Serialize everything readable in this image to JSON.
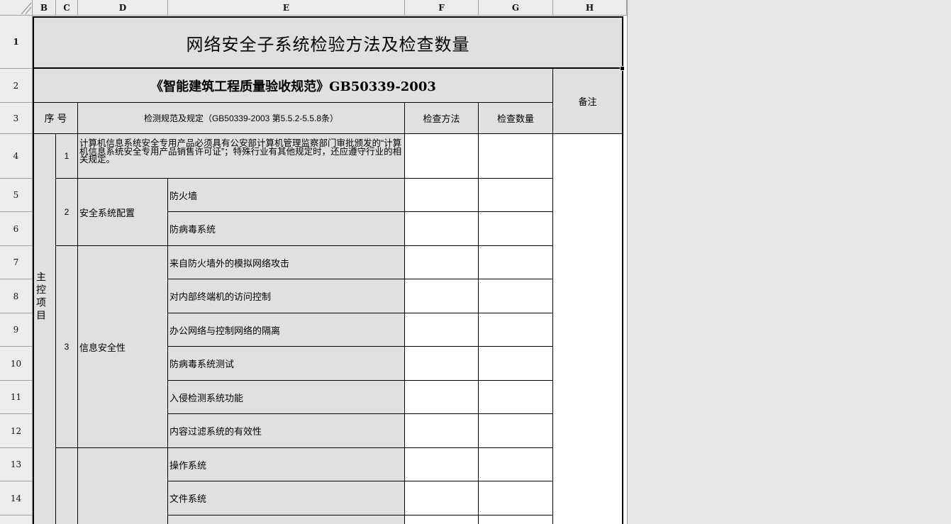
{
  "columns": [
    "B",
    "C",
    "D",
    "E",
    "F",
    "G",
    "H"
  ],
  "rows": [
    "1",
    "2",
    "3",
    "4",
    "5",
    "6",
    "7",
    "8",
    "9",
    "10",
    "11",
    "12",
    "13",
    "14"
  ],
  "sheet": {
    "title": "网络安全子系统检验方法及检查数量",
    "subtitle": "《智能建筑工程质量验收规范》GB50339-2003",
    "remark_header": "备注",
    "header": {
      "seq": "序 号",
      "spec": "检测规范及规定（GB50339-2003 第5.5.2-5.5.8条）",
      "method": "检查方法",
      "quantity": "检查数量"
    },
    "category_label": "主控项目",
    "items": [
      {
        "no": "1",
        "text": "计算机信息系统安全专用产品必须具有公安部计算机管理监察部门审批颁发的“计算机信息系统安全专用产品销售许可证”；特殊行业有其他规定时，还应遵守行业的相关规定。"
      },
      {
        "no": "2",
        "group": "安全系统配置",
        "subitems": [
          "防火墙",
          "防病毒系统"
        ]
      },
      {
        "no": "3",
        "group": "信息安全性",
        "subitems": [
          "来自防火墙外的模拟网络攻击",
          "对内部终端机的访问控制",
          "办公网络与控制网络的隔离",
          "防病毒系统测试",
          "入侵检测系统功能",
          "内容过滤系统的有效性"
        ]
      },
      {
        "no": "",
        "group": "",
        "subitems": [
          "操作系统",
          "文件系统"
        ]
      }
    ]
  }
}
